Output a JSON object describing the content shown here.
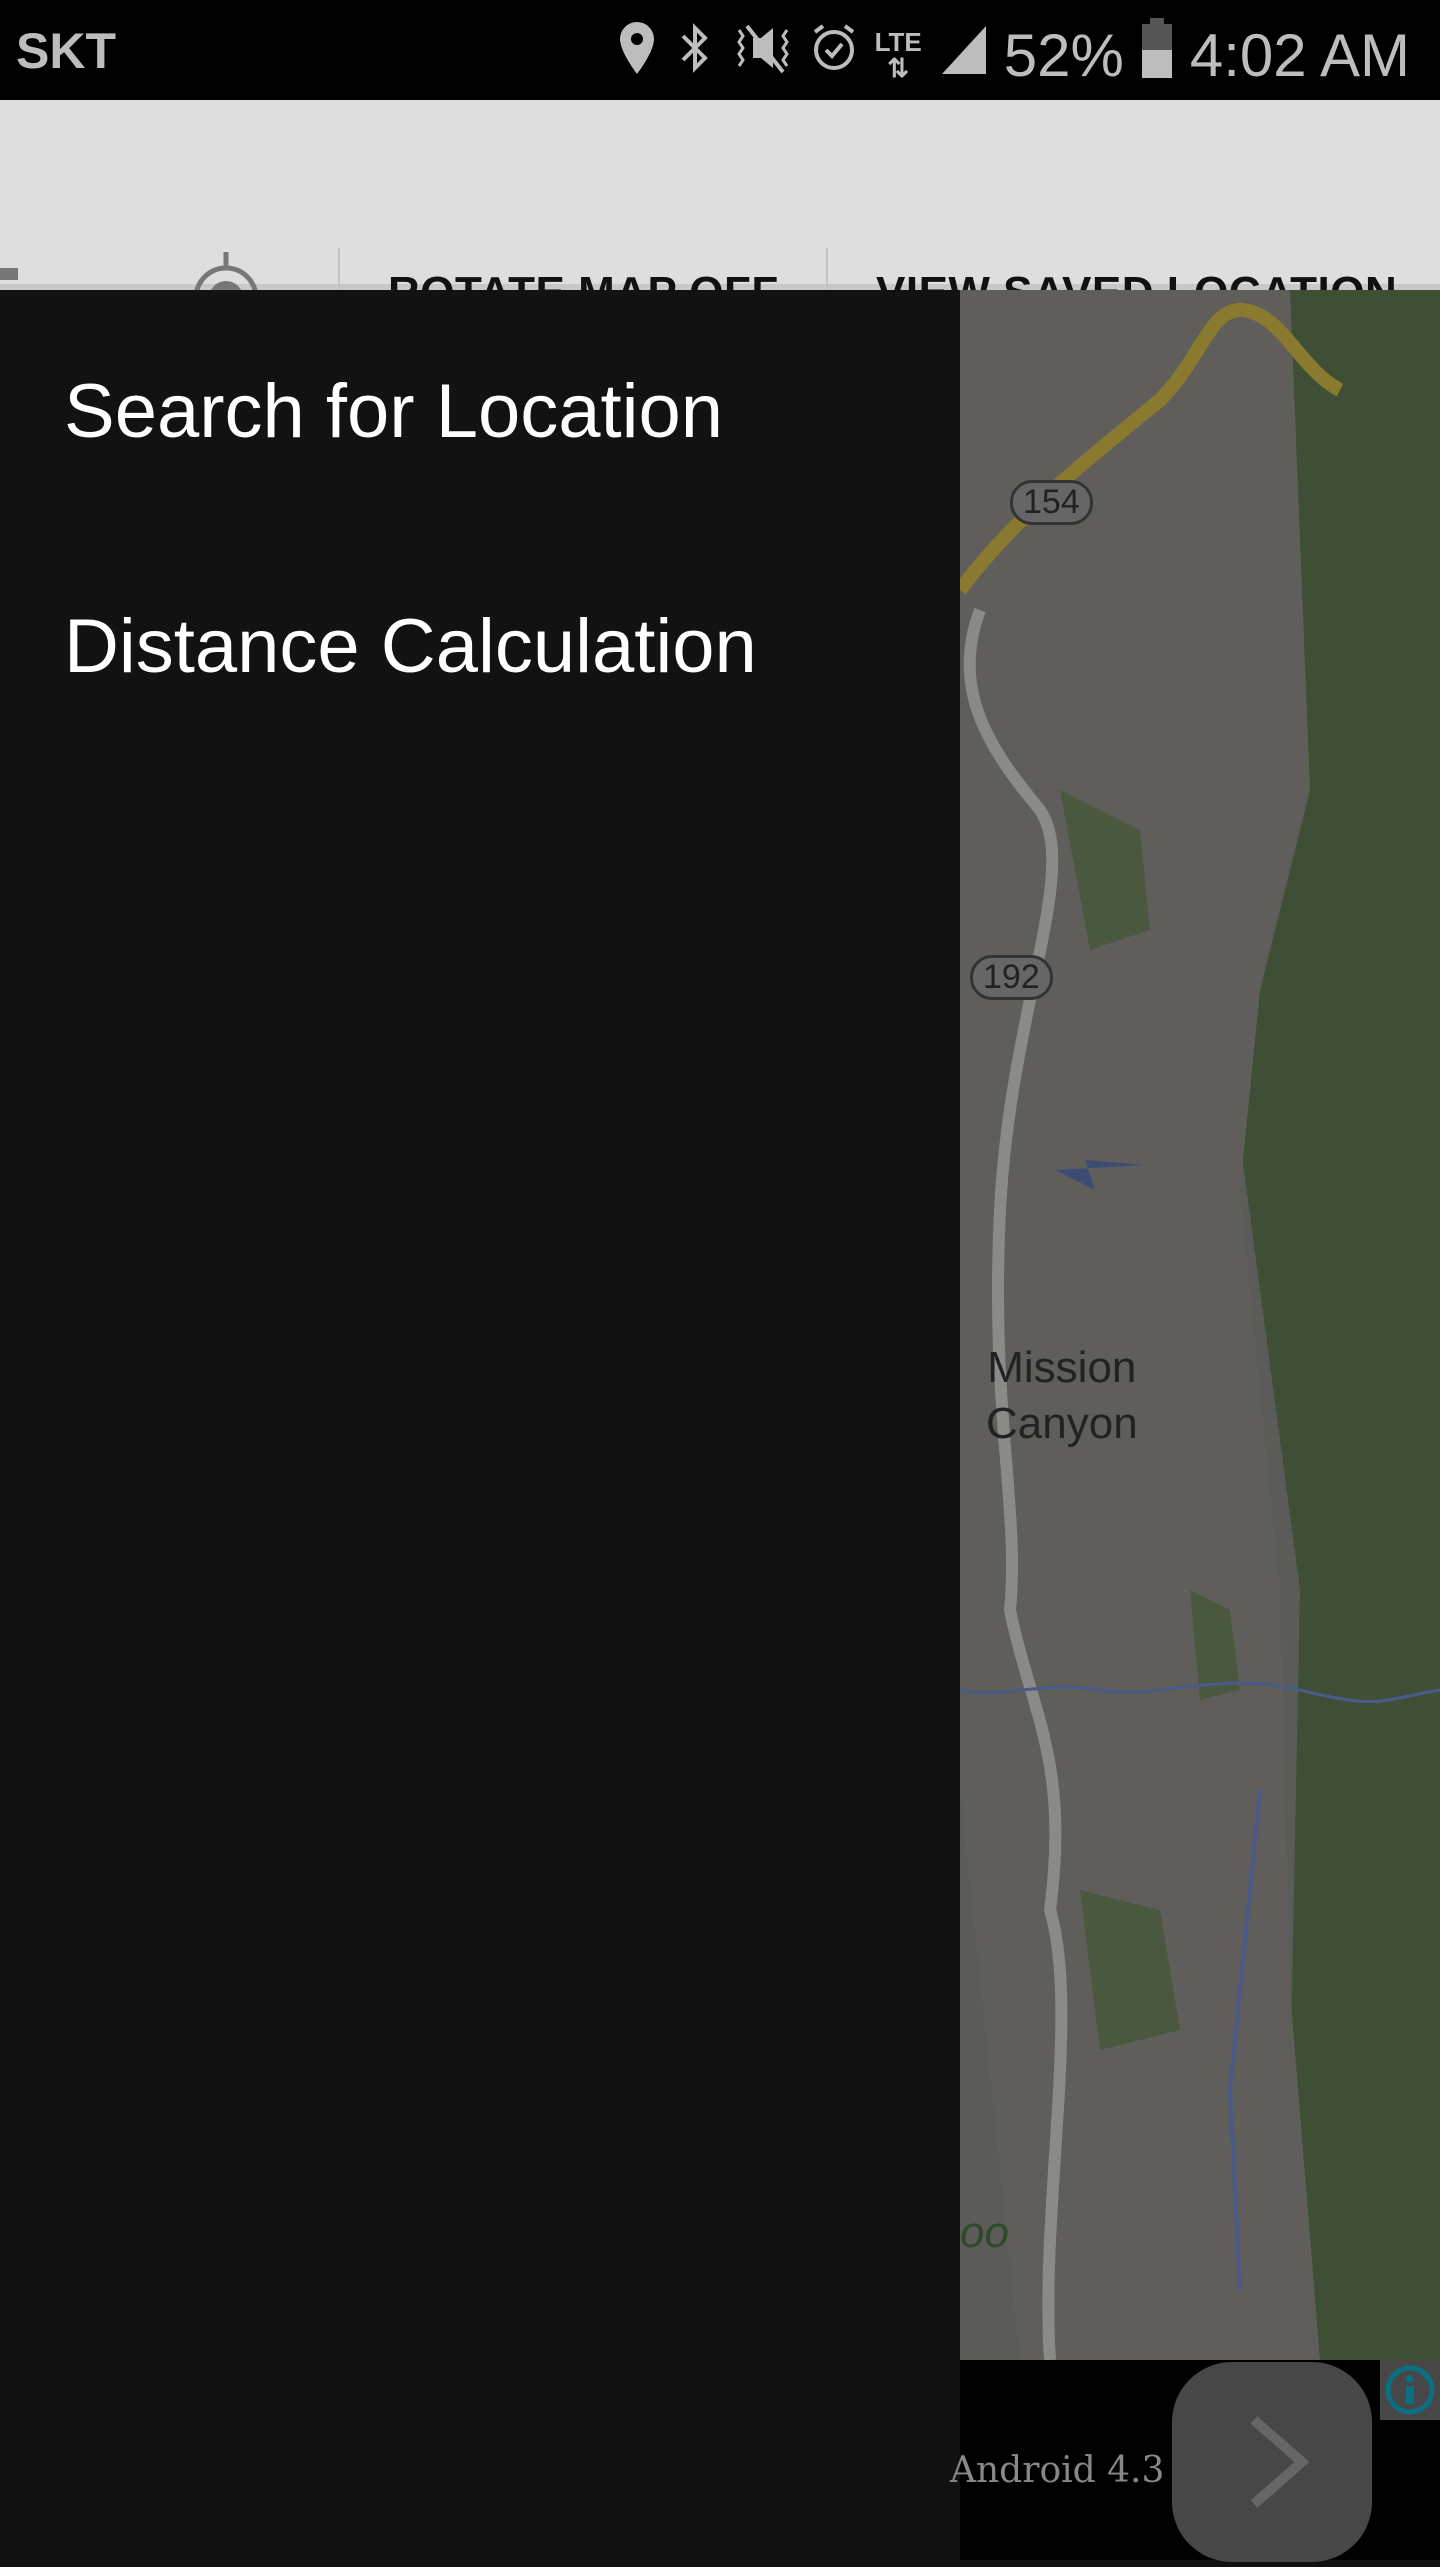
{
  "status_bar": {
    "carrier": "SKT",
    "icons": [
      "location-pin-icon",
      "bluetooth-icon",
      "vibrate-mute-icon",
      "alarm-icon",
      "lte-icon",
      "signal-icon"
    ],
    "battery_percent": "52%",
    "battery_level": 52,
    "time": "4:02 AM"
  },
  "toolbar": {
    "rotate_map": "ROTATE MAP OFF",
    "view_saved": "VIEW SAVED LOCATION"
  },
  "drawer": {
    "items": [
      {
        "label": "Search for Location"
      },
      {
        "label": "Distance Calculation"
      }
    ]
  },
  "map": {
    "route_154": "154",
    "route_192": "192",
    "place": "Mission\nCanyon",
    "partial_label": "oo"
  },
  "ad": {
    "text": "Android 4.3",
    "colors": {
      "info": "#0a6f80"
    }
  }
}
